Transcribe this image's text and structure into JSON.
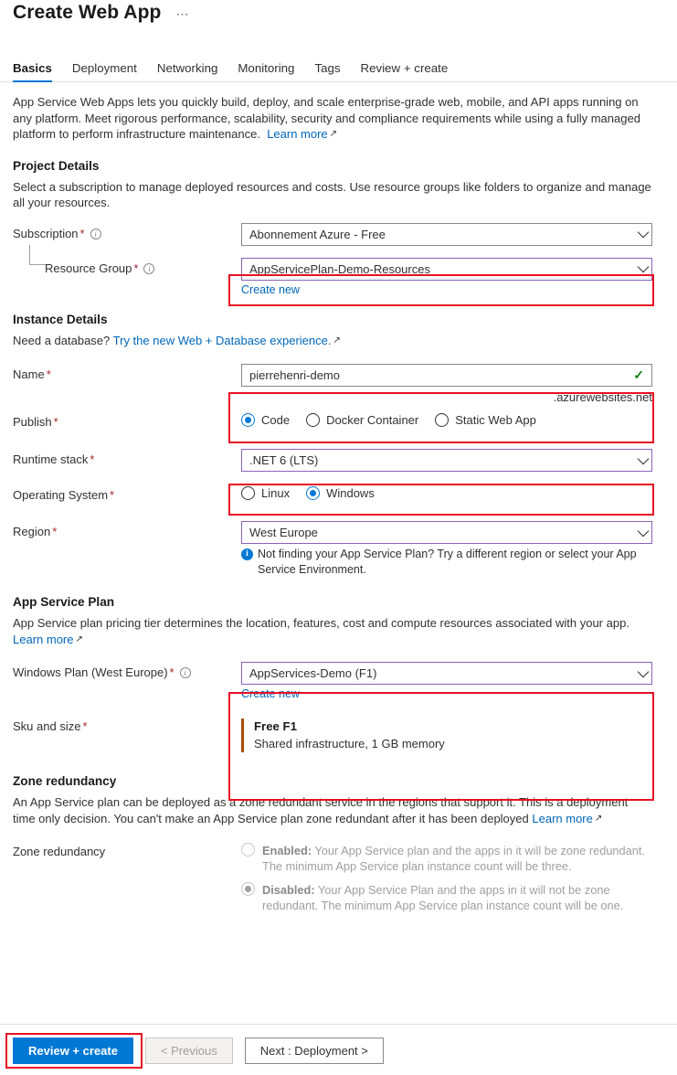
{
  "header": {
    "title": "Create Web App",
    "more_label": "⋯"
  },
  "tabs": [
    {
      "label": "Basics",
      "active": true
    },
    {
      "label": "Deployment",
      "active": false
    },
    {
      "label": "Networking",
      "active": false
    },
    {
      "label": "Monitoring",
      "active": false
    },
    {
      "label": "Tags",
      "active": false
    },
    {
      "label": "Review + create",
      "active": false
    }
  ],
  "intro": {
    "text": "App Service Web Apps lets you quickly build, deploy, and scale enterprise-grade web, mobile, and API apps running on any platform. Meet rigorous performance, scalability, security and compliance requirements while using a fully managed platform to perform infrastructure maintenance.",
    "learn_more": "Learn more"
  },
  "project_details": {
    "heading": "Project Details",
    "description": "Select a subscription to manage deployed resources and costs. Use resource groups like folders to organize and manage all your resources.",
    "subscription": {
      "label": "Subscription",
      "value": "Abonnement Azure - Free"
    },
    "resource_group": {
      "label": "Resource Group",
      "value": "AppServicePlan-Demo-Resources",
      "create_new": "Create new"
    }
  },
  "instance_details": {
    "heading": "Instance Details",
    "database_prompt": "Need a database?",
    "database_link": "Try the new Web + Database experience.",
    "name": {
      "label": "Name",
      "value": "pierrehenri-demo",
      "suffix": ".azurewebsites.net",
      "valid_mark": "✓"
    },
    "publish": {
      "label": "Publish",
      "options": [
        {
          "label": "Code",
          "selected": true
        },
        {
          "label": "Docker Container",
          "selected": false
        },
        {
          "label": "Static Web App",
          "selected": false
        }
      ]
    },
    "runtime_stack": {
      "label": "Runtime stack",
      "value": ".NET 6 (LTS)"
    },
    "operating_system": {
      "label": "Operating System",
      "options": [
        {
          "label": "Linux",
          "selected": false
        },
        {
          "label": "Windows",
          "selected": true
        }
      ]
    },
    "region": {
      "label": "Region",
      "value": "West Europe",
      "note": "Not finding your App Service Plan? Try a different region or select your App Service Environment."
    }
  },
  "app_service_plan": {
    "heading": "App Service Plan",
    "description": "App Service plan pricing tier determines the location, features, cost and compute resources associated with your app.",
    "learn_more": "Learn more",
    "windows_plan": {
      "label": "Windows Plan (West Europe)",
      "value": "AppServices-Demo (F1)",
      "create_new": "Create new"
    },
    "sku_and_size": {
      "label": "Sku and size",
      "tier": "Free F1",
      "detail": "Shared infrastructure, 1 GB memory"
    }
  },
  "zone_redundancy": {
    "heading": "Zone redundancy",
    "description": "An App Service plan can be deployed as a zone redundant service in the regions that support it. This is a deployment time only decision. You can't make an App Service plan zone redundant after it has been deployed",
    "learn_more": "Learn more",
    "label": "Zone redundancy",
    "options": [
      {
        "bold": "Enabled:",
        "text": " Your App Service plan and the apps in it will be zone redundant. The minimum App Service plan instance count will be three.",
        "selected": false
      },
      {
        "bold": "Disabled:",
        "text": " Your App Service Plan and the apps in it will not be zone redundant. The minimum App Service plan instance count will be one.",
        "selected": true
      }
    ]
  },
  "footer": {
    "review_create": "Review + create",
    "previous": "< Previous",
    "next": "Next : Deployment >"
  },
  "colors": {
    "accent": "#0078d4",
    "link": "#0067b8",
    "required": "#a4262c",
    "highlight_box": "#e81123",
    "focused_border": "#8764b8",
    "sku_bar": "#a64d00",
    "valid": "#107c10"
  }
}
